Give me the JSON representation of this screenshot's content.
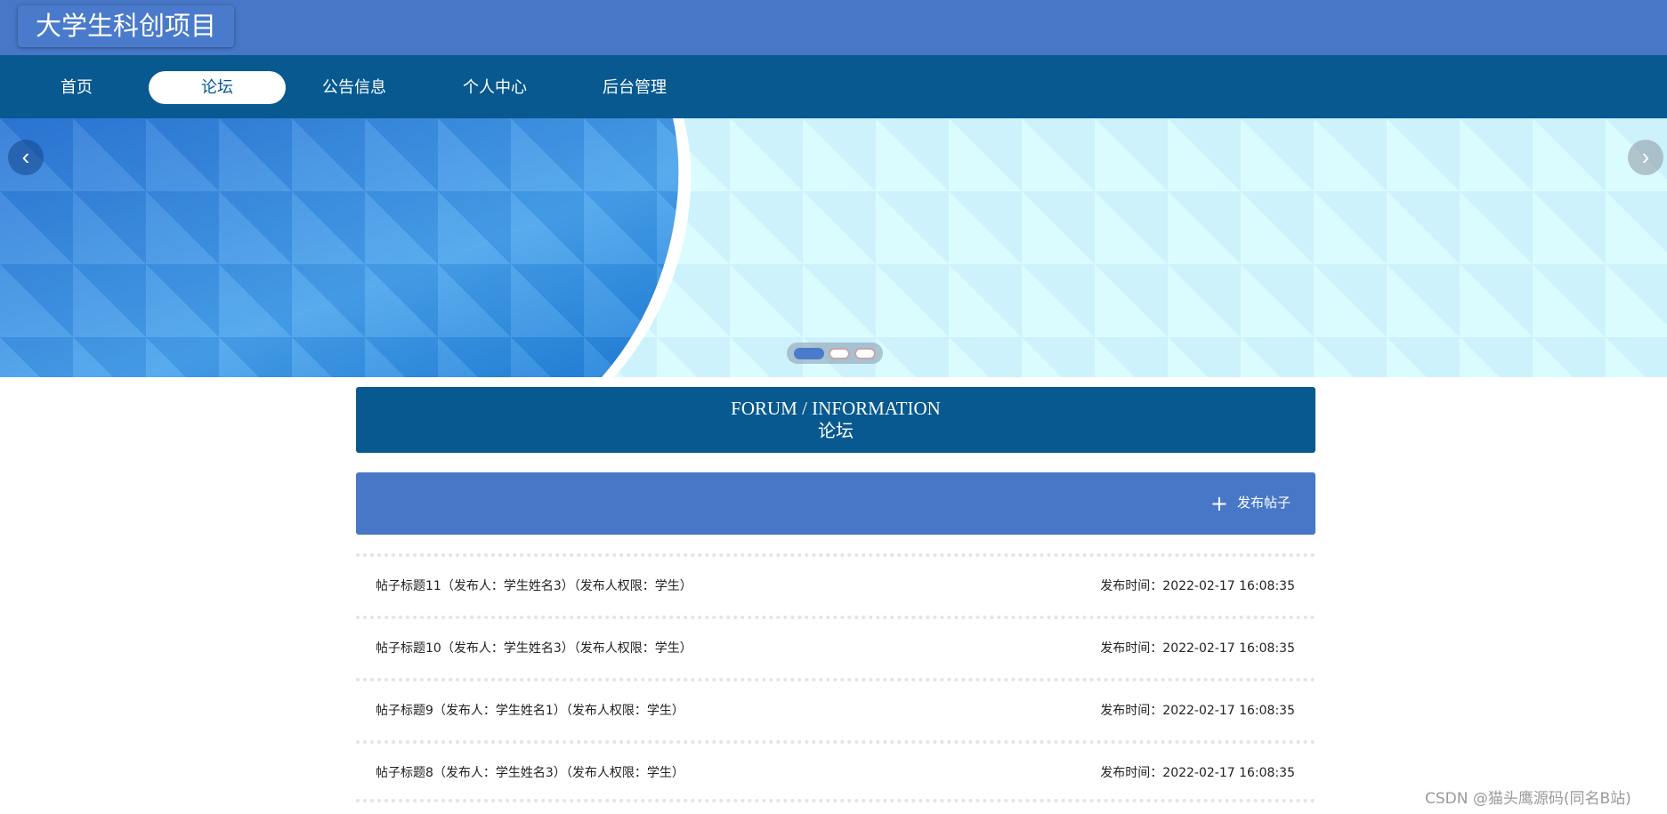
{
  "header": {
    "site_title": "大学生科创项目"
  },
  "nav": {
    "items": [
      {
        "label": "首页",
        "active": false
      },
      {
        "label": "论坛",
        "active": true
      },
      {
        "label": "公告信息",
        "active": false
      },
      {
        "label": "个人中心",
        "active": false
      },
      {
        "label": "后台管理",
        "active": false
      }
    ]
  },
  "banner": {
    "prev_icon": "chevron-left-icon",
    "next_icon": "chevron-right-icon",
    "slide_count": 3,
    "active_slide": 1,
    "colors": {
      "left_panel": "#3e8fe0",
      "right_panel": "#d3fbff"
    }
  },
  "section": {
    "title_en": "FORUM / INFORMATION",
    "title_cn": "论坛"
  },
  "actions": {
    "post_button_icon": "plus-icon",
    "post_button_label": "发布帖子"
  },
  "posts": [
    {
      "title": "帖子标题11（发布人：学生姓名3）（发布人权限：学生）",
      "time": "发布时间：2022-02-17 16:08:35"
    },
    {
      "title": "帖子标题10（发布人：学生姓名3）（发布人权限：学生）",
      "time": "发布时间：2022-02-17 16:08:35"
    },
    {
      "title": "帖子标题9（发布人：学生姓名1）（发布人权限：学生）",
      "time": "发布时间：2022-02-17 16:08:35"
    },
    {
      "title": "帖子标题8（发布人：学生姓名3）（发布人权限：学生）",
      "time": "发布时间：2022-02-17 16:08:35"
    }
  ],
  "watermark": "CSDN @猫头鹰源码(同名B站)",
  "colors": {
    "topbar": "#4777c6",
    "navbar": "#075990",
    "section_header": "#075990",
    "action_bar": "#4777c6"
  }
}
